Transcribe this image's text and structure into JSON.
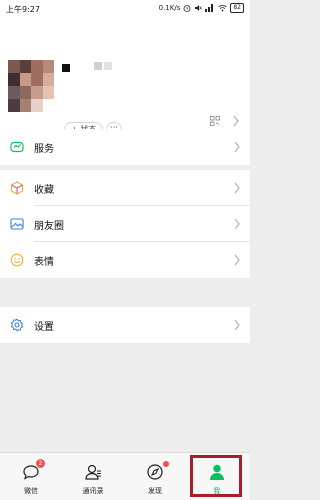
{
  "status_bar": {
    "time": "上午9:27",
    "network_speed": "0.1K/s",
    "battery": "82"
  },
  "profile": {
    "status_button": "+ 状态",
    "more_button": "···"
  },
  "menu": {
    "services": "服务",
    "favorites": "收藏",
    "moments": "朋友圈",
    "stickers": "表情",
    "settings": "设置"
  },
  "tabbar": {
    "chats": "微信",
    "chats_badge": "2",
    "contacts": "通讯录",
    "discover": "发现",
    "me": "我"
  },
  "colors": {
    "accent": "#07c160",
    "badge": "#f35151",
    "highlight": "#a6202a"
  }
}
